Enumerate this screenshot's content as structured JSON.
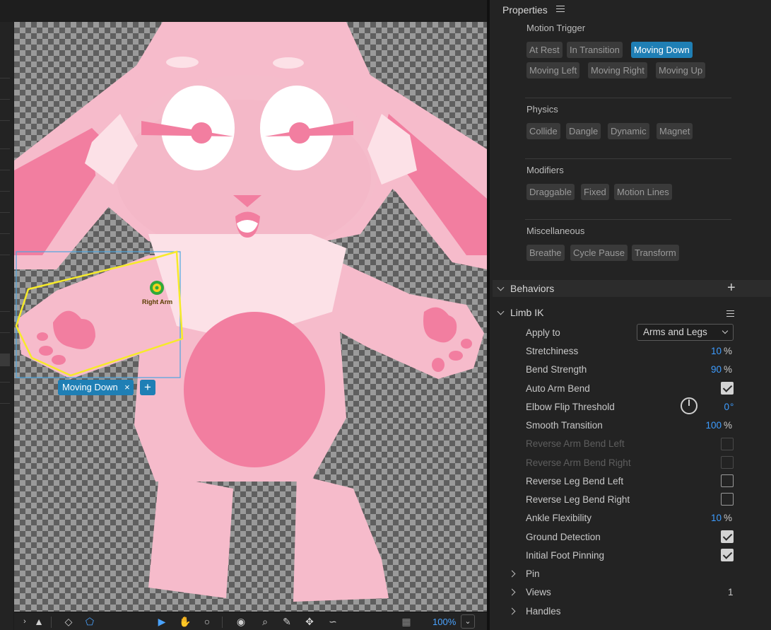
{
  "panel": {
    "title": "Properties"
  },
  "motion_trigger": {
    "title": "Motion Trigger",
    "chips": [
      "At Rest",
      "In Transition",
      "Moving Down",
      "Moving Left",
      "Moving Right",
      "Moving Up"
    ],
    "active": "Moving Down"
  },
  "physics": {
    "title": "Physics",
    "chips": [
      "Collide",
      "Dangle",
      "Dynamic",
      "Magnet"
    ]
  },
  "modifiers": {
    "title": "Modifiers",
    "chips": [
      "Draggable",
      "Fixed",
      "Motion Lines"
    ]
  },
  "misc": {
    "title": "Miscellaneous",
    "chips": [
      "Breathe",
      "Cycle Pause",
      "Transform"
    ]
  },
  "behaviors": {
    "title": "Behaviors",
    "add_icon": "plus-icon"
  },
  "limb_ik": {
    "title": "Limb IK",
    "apply_to": {
      "label": "Apply to",
      "value": "Arms and Legs"
    },
    "stretchiness": {
      "label": "Stretchiness",
      "value": "10",
      "unit": "%"
    },
    "bend_strength": {
      "label": "Bend Strength",
      "value": "90",
      "unit": "%"
    },
    "auto_arm_bend": {
      "label": "Auto Arm Bend",
      "checked": true
    },
    "elbow_flip": {
      "label": "Elbow Flip Threshold",
      "value": "0",
      "unit": "°"
    },
    "smooth_transition": {
      "label": "Smooth Transition",
      "value": "100",
      "unit": "%"
    },
    "reverse_arm_left": {
      "label": "Reverse Arm Bend Left",
      "checked": false,
      "disabled": true
    },
    "reverse_arm_right": {
      "label": "Reverse Arm Bend Right",
      "checked": false,
      "disabled": true
    },
    "reverse_leg_left": {
      "label": "Reverse Leg Bend Left",
      "checked": false
    },
    "reverse_leg_right": {
      "label": "Reverse Leg Bend Right",
      "checked": false
    },
    "ankle_flex": {
      "label": "Ankle Flexibility",
      "value": "10",
      "unit": "%"
    },
    "ground_detection": {
      "label": "Ground Detection",
      "checked": true
    },
    "initial_foot_pinning": {
      "label": "Initial Foot Pinning",
      "checked": true
    }
  },
  "subgroups": {
    "pin": {
      "label": "Pin"
    },
    "views": {
      "label": "Views",
      "count": "1"
    },
    "handles": {
      "label": "Handles"
    }
  },
  "canvas": {
    "tag_label": "Moving Down",
    "tag_remove": "×",
    "tag_add": "+",
    "handle_label": "Right Arm",
    "zoom": "100%"
  },
  "colors": {
    "accent": "#1f7fb5",
    "value_blue": "#3d9cff",
    "bunny_pink": "#f6bbcb",
    "bunny_dark_pink": "#f27ea0"
  }
}
